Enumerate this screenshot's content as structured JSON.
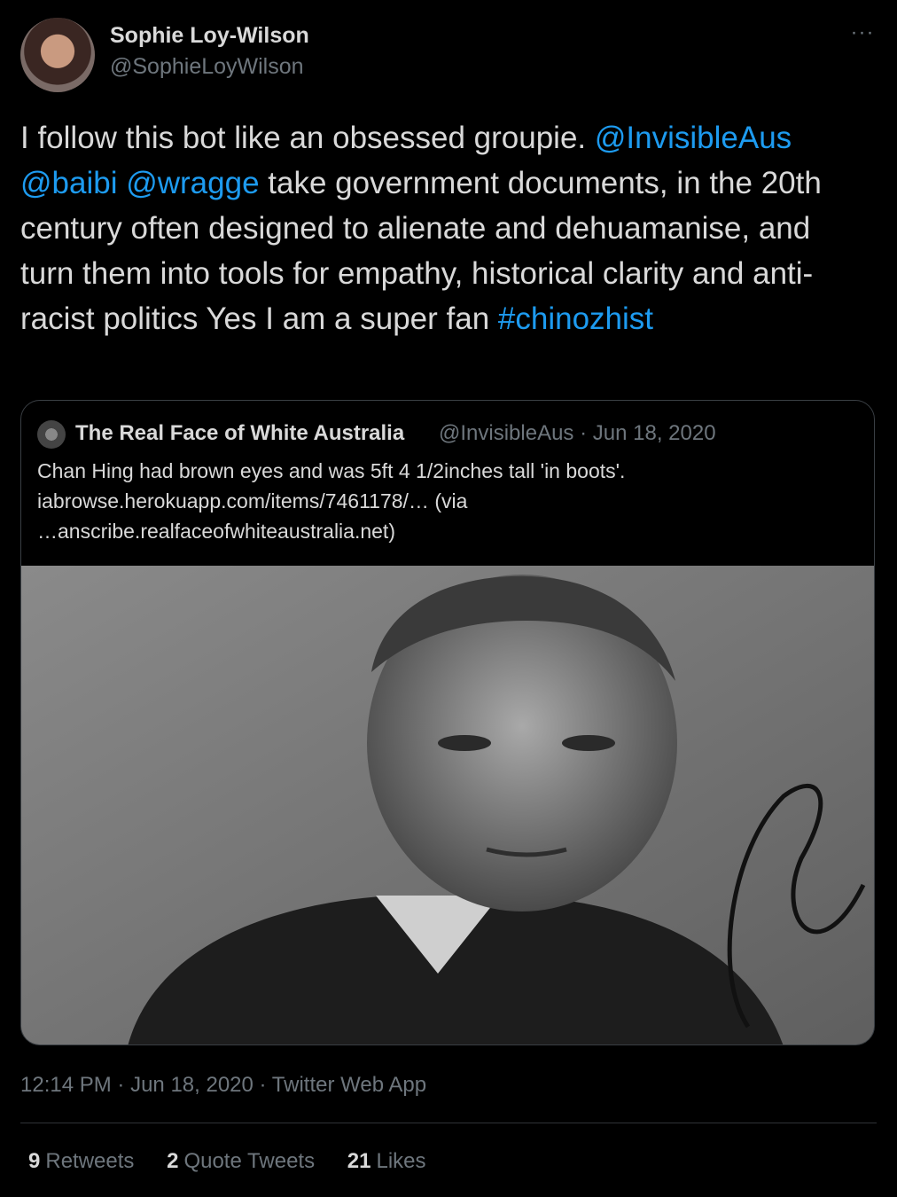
{
  "author": {
    "name": "Sophie Loy-Wilson",
    "handle": "@SophieLoyWilson"
  },
  "more_icon": "more-horizontal-icon",
  "tweet": {
    "segments": [
      {
        "text": "I follow this bot like an obsessed groupie. ",
        "link": false
      },
      {
        "text": "@InvisibleAus",
        "link": true
      },
      {
        "text": " ",
        "link": false
      },
      {
        "text": "@baibi",
        "link": true
      },
      {
        "text": " ",
        "link": false
      },
      {
        "text": "@wragge",
        "link": true
      },
      {
        "text": " take government documents, in the 20th century often designed to alienate and dehuamanise, and turn them into tools for empathy, historical clarity and anti-racist politics Yes I am a super fan ",
        "link": false
      },
      {
        "text": "#chinozhist",
        "link": true
      }
    ]
  },
  "quoted": {
    "name": "The Real Face of White Australia",
    "handle": "@InvisibleAus",
    "date": "Jun 18, 2020",
    "text_line1": "Chan Hing had brown eyes and was 5ft 4 1/2inches tall 'in boots'.",
    "text_line2": "iabrowse.herokuapp.com/items/7461178/… (via",
    "text_line3": "…anscribe.realfaceofwhiteaustralia.net)"
  },
  "timestamp": {
    "time": "12:14 PM",
    "date": "Jun 18, 2020",
    "source": "Twitter Web App"
  },
  "stats": {
    "retweets_count": "9",
    "retweets_label": "Retweets",
    "quotes_count": "2",
    "quotes_label": "Quote Tweets",
    "likes_count": "21",
    "likes_label": "Likes"
  },
  "colors": {
    "background": "#000000",
    "link": "#1d9bf0",
    "text": "#d9d9d9",
    "secondary": "#6e767d"
  }
}
